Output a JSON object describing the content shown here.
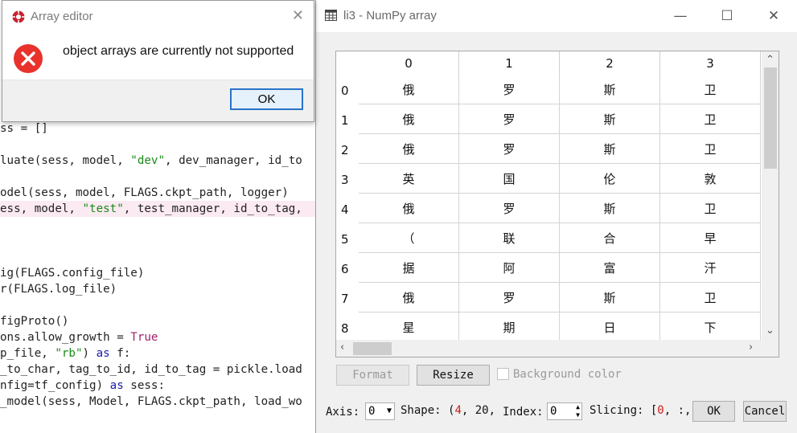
{
  "code_editor": {
    "lines": [
      {
        "parts": [
          {
            "t": "ss = []",
            "c": ""
          }
        ]
      },
      {
        "parts": [
          {
            "t": "luate(sess, model, ",
            "c": ""
          },
          {
            "t": "\"dev\"",
            "c": "str"
          },
          {
            "t": ", dev_manager, id_to",
            "c": ""
          }
        ]
      },
      {
        "parts": [
          {
            "t": "odel(sess, model, FLAGS.ckpt_path, logger)",
            "c": ""
          }
        ]
      },
      {
        "parts": [
          {
            "t": "ess, model, ",
            "c": ""
          },
          {
            "t": "\"test\"",
            "c": "str"
          },
          {
            "t": ", test_manager, id_to_tag,",
            "c": ""
          }
        ]
      },
      {
        "parts": [
          {
            "t": "ig(FLAGS.config_file)",
            "c": ""
          }
        ]
      },
      {
        "parts": [
          {
            "t": "r(FLAGS.log_file)",
            "c": ""
          }
        ]
      },
      {
        "parts": [
          {
            "t": "figProto()",
            "c": ""
          }
        ]
      },
      {
        "parts": [
          {
            "t": "ons.allow_growth = ",
            "c": ""
          },
          {
            "t": "True",
            "c": "kw2"
          }
        ]
      },
      {
        "parts": [
          {
            "t": "p_file, ",
            "c": ""
          },
          {
            "t": "\"rb\"",
            "c": "str"
          },
          {
            "t": ") ",
            "c": ""
          },
          {
            "t": "as",
            "c": "kw"
          },
          {
            "t": " f:",
            "c": ""
          }
        ]
      },
      {
        "parts": [
          {
            "t": "_to_char, tag_to_id, id_to_tag = pickle.load",
            "c": ""
          }
        ]
      },
      {
        "parts": [
          {
            "t": "nfig=tf_config) ",
            "c": ""
          },
          {
            "t": "as",
            "c": "kw"
          },
          {
            "t": " sess:",
            "c": ""
          }
        ]
      },
      {
        "parts": [
          {
            "t": "_model(sess, Model, FLAGS.ckpt_path, load_wo",
            "c": ""
          }
        ]
      }
    ]
  },
  "error_dialog": {
    "title": "Array editor",
    "message": "object arrays are currently not supported",
    "ok_label": "OK",
    "close_glyph": "✕",
    "icon": "error-icon"
  },
  "array_window": {
    "title": "li3 - NumPy array",
    "controls": {
      "minimize": "—",
      "maximize": "☐",
      "close": "✕"
    },
    "table": {
      "columns": [
        "0",
        "1",
        "2",
        "3"
      ],
      "rows": [
        {
          "index": "0",
          "cells": [
            "俄",
            "罗",
            "斯",
            "卫"
          ]
        },
        {
          "index": "1",
          "cells": [
            "俄",
            "罗",
            "斯",
            "卫"
          ]
        },
        {
          "index": "2",
          "cells": [
            "俄",
            "罗",
            "斯",
            "卫"
          ]
        },
        {
          "index": "3",
          "cells": [
            "英",
            "国",
            "伦",
            "敦"
          ]
        },
        {
          "index": "4",
          "cells": [
            "俄",
            "罗",
            "斯",
            "卫"
          ]
        },
        {
          "index": "5",
          "cells": [
            "（",
            "联",
            "合",
            "早"
          ]
        },
        {
          "index": "6",
          "cells": [
            "据",
            "阿",
            "富",
            "汗"
          ]
        },
        {
          "index": "7",
          "cells": [
            "俄",
            "罗",
            "斯",
            "卫"
          ]
        },
        {
          "index": "8",
          "cells": [
            "星",
            "期",
            "日",
            "下"
          ]
        }
      ]
    },
    "buttons": {
      "format": "Format",
      "resize": "Resize",
      "ok": "OK",
      "cancel": "Cancel"
    },
    "background_color_label": "Background color",
    "axis_label": "Axis:",
    "axis_value": "0",
    "shape_label": "Shape: (",
    "shape_dim0": "4",
    "shape_rest": ", 20,",
    "index_label": "Index:",
    "index_value": "0",
    "slicing_label": "Slicing: [",
    "slicing_dim0": "0",
    "slicing_rest": ", :,"
  }
}
